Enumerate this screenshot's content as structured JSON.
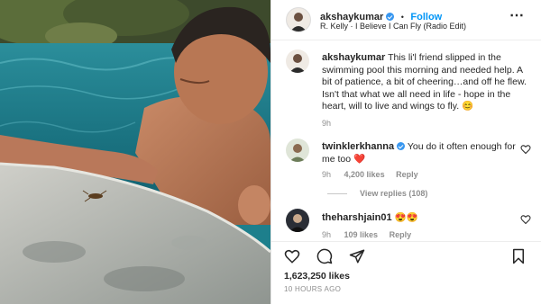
{
  "post": {
    "username": "akshaykumar",
    "follow_label": "Follow",
    "separator": "•",
    "audio": "R. Kelly · I Believe I Can Fly (Radio Edit)",
    "more_glyph": "⋯"
  },
  "caption": {
    "username": "akshaykumar",
    "text": "This li'l friend slipped in the swimming pool this morning and needed help. A bit of patience, a bit of cheering…and off he flew. Isn't that what we all need in life - hope in the heart, will to live and wings to fly. 😊",
    "time": "9h"
  },
  "comments": [
    {
      "username": "twinklerkhanna",
      "text": "You do it often enough for me too ❤️",
      "time": "9h",
      "likes": "4,200 likes",
      "reply_label": "Reply",
      "view_replies": "View replies (108)"
    },
    {
      "username": "theharshjain01",
      "text": "😍😍",
      "time": "9h",
      "likes": "109 likes",
      "reply_label": "Reply"
    }
  ],
  "stats": {
    "likes": "1,623,250 likes",
    "timestamp": "10 HOURS AGO"
  },
  "icons": {
    "like": "heart-icon",
    "comment": "comment-icon",
    "share": "share-icon",
    "save": "bookmark-icon",
    "verified": "verified-badge-icon",
    "more": "more-options-icon"
  },
  "colors": {
    "verified": "#3897f0",
    "follow": "#0095f6",
    "meta_text": "#8e8e8e",
    "heart_emoji": "#ed4956"
  }
}
